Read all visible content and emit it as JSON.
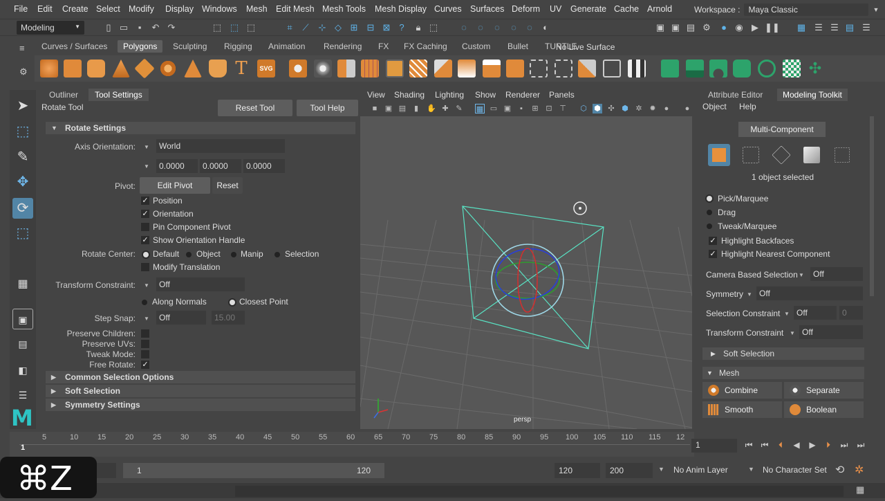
{
  "menubar": {
    "items": [
      "File",
      "Edit",
      "Create",
      "Select",
      "Modify",
      "Display",
      "Windows",
      "Mesh",
      "Edit Mesh",
      "Mesh Tools",
      "Mesh Display",
      "Curves",
      "Surfaces",
      "Deform",
      "UV",
      "Generate",
      "Cache",
      "Arnold"
    ],
    "workspace_label": "Workspace :",
    "workspace_value": "Maya Classic"
  },
  "statusline": {
    "mode": "Modeling",
    "live_surface": "No Live Surface"
  },
  "shelf": {
    "tabs": [
      "Curves / Surfaces",
      "Polygons",
      "Sculpting",
      "Rigging",
      "Animation",
      "Rendering",
      "FX",
      "FX Caching",
      "Custom",
      "Bullet",
      "TURTLE"
    ],
    "active_tab": "Polygons",
    "type_text": "T",
    "svg_text": "SVG"
  },
  "toolpanel": {
    "tabs": [
      "Outliner",
      "Tool Settings"
    ],
    "active_tab": "Tool Settings",
    "tool_name": "Rotate Tool",
    "reset_tool": "Reset Tool",
    "tool_help": "Tool Help",
    "rotate_settings": "Rotate Settings",
    "axis_orientation_label": "Axis Orientation:",
    "axis_orientation_value": "World",
    "axis_values": [
      "0.0000",
      "0.0000",
      "0.0000"
    ],
    "pivot_label": "Pivot:",
    "edit_pivot": "Edit Pivot",
    "reset": "Reset",
    "position": "Position",
    "orientation": "Orientation",
    "pin_component_pivot": "Pin Component Pivot",
    "show_orientation_handle": "Show Orientation Handle",
    "rotate_center_label": "Rotate Center:",
    "rc_default": "Default",
    "rc_object": "Object",
    "rc_manip": "Manip",
    "rc_selection": "Selection",
    "modify_translation": "Modify Translation",
    "transform_constraint_label": "Transform Constraint:",
    "transform_constraint_value": "Off",
    "along_normals": "Along Normals",
    "closest_point": "Closest Point",
    "step_snap_label": "Step Snap:",
    "step_snap_value": "Off",
    "step_snap_amount": "15.00",
    "preserve_children": "Preserve Children:",
    "preserve_uvs": "Preserve UVs:",
    "tweak_mode": "Tweak Mode:",
    "free_rotate": "Free Rotate:",
    "common_selection_options": "Common Selection Options",
    "soft_selection": "Soft Selection",
    "symmetry_settings": "Symmetry Settings",
    "check_mark": "✓"
  },
  "viewport": {
    "menu": [
      "View",
      "Shading",
      "Lighting",
      "Show",
      "Renderer",
      "Panels"
    ],
    "camera": "persp"
  },
  "rightpanel": {
    "tabs": [
      "Attribute Editor",
      "Modeling Toolkit"
    ],
    "active_tab": "Modeling Toolkit",
    "menu": [
      "Object",
      "Help"
    ],
    "multi_component": "Multi-Component",
    "objects_selected": "1 object selected",
    "pick_marquee": "Pick/Marquee",
    "drag": "Drag",
    "tweak_marquee": "Tweak/Marquee",
    "highlight_backfaces": "Highlight Backfaces",
    "highlight_nearest": "Highlight Nearest Component",
    "camera_based_selection": "Camera Based Selection",
    "camera_based_value": "Off",
    "symmetry": "Symmetry",
    "symmetry_value": "Off",
    "selection_constraint": "Selection Constraint",
    "selection_constraint_value": "Off",
    "selection_constraint_num": "0",
    "transform_constraint": "Transform Constraint",
    "transform_constraint_value": "Off",
    "soft_selection": "Soft Selection",
    "mesh": "Mesh",
    "combine": "Combine",
    "separate": "Separate",
    "smooth": "Smooth",
    "boolean": "Boolean"
  },
  "timeline": {
    "ticks": [
      "5",
      "10",
      "15",
      "20",
      "25",
      "30",
      "35",
      "40",
      "45",
      "50",
      "55",
      "60",
      "65",
      "70",
      "75",
      "80",
      "85",
      "90",
      "95",
      "100",
      "105",
      "110",
      "115",
      "12"
    ],
    "current_frame": "1",
    "frame_field": "1"
  },
  "rangebar": {
    "range_start": "1",
    "range_end": "120",
    "anim_end": "120",
    "anim_total": "200",
    "anim_layer": "No Anim Layer",
    "character_set": "No Character Set"
  },
  "shortcut_overlay": "⌘Z"
}
